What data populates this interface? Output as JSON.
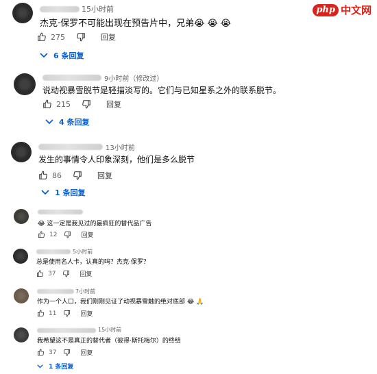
{
  "watermark": {
    "badge": "php",
    "text": "中文网"
  },
  "ui": {
    "reply_label": "回复"
  },
  "comments": [
    {
      "time": "15小时前",
      "text": "杰克·保罗不可能出现在预告片中，兄弟😭 😭 😭",
      "likes": "275",
      "replies": "6 条回复"
    },
    {
      "time": "9小时前（修改过）",
      "text": "说动视暴雪脱节是轻描淡写的。它们与已知星系之外的联系脱节。",
      "likes": "215",
      "replies": "4 条回复"
    },
    {
      "time": "13小时前",
      "text": "发生的事情令人印象深刻，他们是多么脱节",
      "likes": "86",
      "replies": "1 条回复"
    },
    {
      "time": "",
      "text": "😂 这一定是我见过的最疯狂的替代品广告",
      "likes": "12",
      "replies": ""
    },
    {
      "time": "5小时前",
      "text": "总是使用名人卡，认真的吗？杰克·保罗？",
      "likes": "37",
      "replies": ""
    },
    {
      "time": "7小时前",
      "text": "作为一个人口，我们刚刚见证了动视暴雪触的绝对底部 😂 🙏",
      "likes": "11",
      "replies": ""
    },
    {
      "time": "15小时前",
      "text": "我希望这不是真正的替代者（彼得·斯托梅尔）的终结",
      "likes": "37",
      "replies": "1 条回复"
    }
  ]
}
